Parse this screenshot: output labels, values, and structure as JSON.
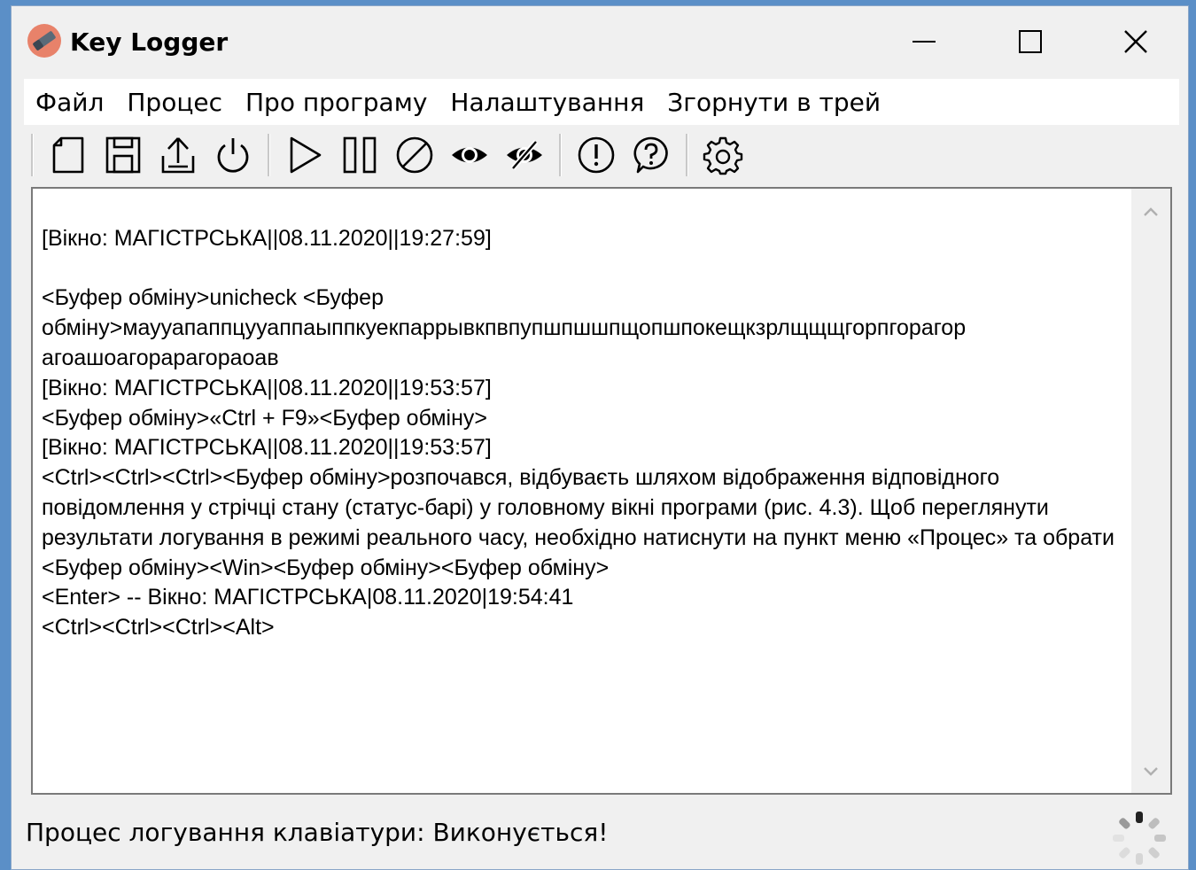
{
  "window": {
    "title": "Key Logger",
    "icon": "pencil-app-icon",
    "controls": [
      "minimize-icon",
      "maximize-icon",
      "close-icon"
    ]
  },
  "menu": {
    "items": [
      {
        "label": "Файл"
      },
      {
        "label": "Процес"
      },
      {
        "label": "Про програму"
      },
      {
        "label": "Налаштування"
      },
      {
        "label": "Згорнути в трей"
      }
    ]
  },
  "toolbar": {
    "buttons": [
      "new-file-icon",
      "save-icon",
      "export-icon",
      "power-icon",
      "play-icon",
      "pause-icon",
      "stop-icon",
      "show-eye-icon",
      "hide-eye-icon",
      "info-alert-icon",
      "help-icon",
      "settings-gear-icon"
    ]
  },
  "log": {
    "text": "\n[Вікно: МАГІСТРСЬКА||08.11.2020||19:27:59]\n\n<Буфер обміну>unicheck <Буфер обміну>маууапаппцууаппаыппкуекпаррывкпвпупшпшшпщопшпокещкзрлщщщгорпгорагор агоашоагорарагораоав\n[Вікно: МАГІСТРСЬКА||08.11.2020||19:53:57]\n<Буфер обміну>«Ctrl + F9»<Буфер обміну>\n[Вікно: МАГІСТРСЬКА||08.11.2020||19:53:57]\n<Ctrl><Ctrl><Ctrl><Буфер обміну>розпочався, відбуваєть шляхом відображення відповідного повідомлення у стрічці стану (статус-барі) у головному вікні програми (рис. 4.3). Щоб переглянути результати логування в режимі реального часу, необхідно натиснути на пункт меню «Процес» та обрати <Буфер обміну><Win><Буфер обміну><Буфер обміну>\n<Enter> -- Вікно: МАГІСТРСЬКА|08.11.2020|19:54:41\n<Ctrl><Ctrl><Ctrl><Alt>"
  },
  "status": {
    "text": "Процес логування клавіатури: Виконується!"
  }
}
